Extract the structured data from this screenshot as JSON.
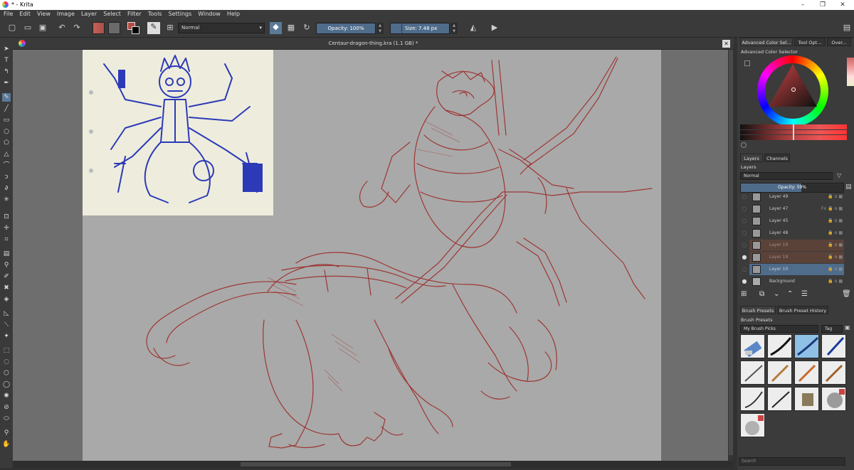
{
  "titlebar": {
    "title": "* - Krita",
    "controls": [
      "–",
      "❐",
      "✕"
    ]
  },
  "menu": [
    "File",
    "Edit",
    "View",
    "Image",
    "Layer",
    "Select",
    "Filter",
    "Tools",
    "Settings",
    "Window",
    "Help"
  ],
  "toolbar": {
    "blend_mode": "Normal",
    "opacity_label": "Opacity: 100%",
    "size_label": "Size: 7.48 px",
    "fg_color": "#b64a43",
    "bg_color": "#5a5a5a"
  },
  "document": {
    "tab_title": "Centaur-dragon-thing.kra (1.1 GB) *",
    "close_glyph": "✕"
  },
  "dock": {
    "color_tabs": [
      "Advanced Color Sel...",
      "Tool Opt...",
      "Over..."
    ],
    "color_title": "Advanced Color Selector",
    "layer_tabs": [
      "Layers",
      "Channels"
    ],
    "layers_title": "Layers",
    "layers_blend": "Normal",
    "layers_opacity": "Opacity: 59%",
    "layers": [
      {
        "name": "Layer 49",
        "visible": false,
        "fx": false,
        "highlight": false,
        "selected": false
      },
      {
        "name": "Layer 47",
        "visible": false,
        "fx": true,
        "highlight": false,
        "selected": false
      },
      {
        "name": "Layer 45",
        "visible": false,
        "fx": false,
        "highlight": false,
        "selected": false
      },
      {
        "name": "Layer 48",
        "visible": false,
        "fx": false,
        "highlight": false,
        "selected": false
      },
      {
        "name": "Layer 19",
        "visible": false,
        "fx": false,
        "highlight": true,
        "selected": false
      },
      {
        "name": "Layer 18",
        "visible": true,
        "fx": false,
        "highlight": true,
        "selected": false
      },
      {
        "name": "Layer 10",
        "visible": false,
        "fx": false,
        "highlight": false,
        "selected": true
      },
      {
        "name": "Background",
        "visible": true,
        "fx": false,
        "highlight": false,
        "selected": false
      }
    ],
    "fx_label": "Fx",
    "brush_tabs": [
      "Brush Presets",
      "Brush Preset History"
    ],
    "brush_title": "Brush Presets",
    "brush_tag": "My Brush Picks",
    "tag_label": "Tag",
    "search_placeholder": "Search"
  },
  "colors": {
    "accent": "#5a7a98",
    "sketch": "#9c2b27",
    "ink": "#2d3ab8"
  }
}
